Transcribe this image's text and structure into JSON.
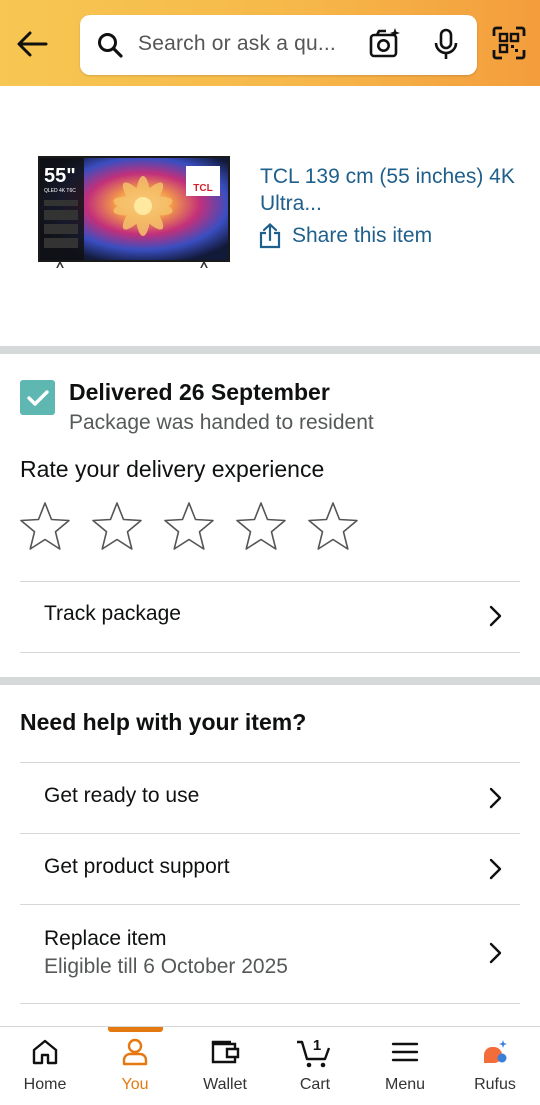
{
  "header": {
    "search_placeholder": "Search or ask a qu...",
    "back_icon": "arrow-left-icon",
    "search_icon": "search-icon",
    "camera_icon": "camera-sparkle-icon",
    "mic_icon": "microphone-icon",
    "scan_icon": "qr-scan-icon",
    "gradient_colors": [
      "#f7c752",
      "#f39d3c"
    ]
  },
  "product": {
    "title": "TCL 139 cm (55 inches) 4K Ultra...",
    "share_label": "Share this item",
    "image_text": {
      "size": "55\"",
      "model": "QLED 4K T6C",
      "brand": "TCL"
    }
  },
  "delivery": {
    "title": "Delivered 26 September",
    "subtitle": "Package was handed to resident",
    "rate_label": "Rate your delivery experience",
    "rating_value": 0,
    "rating_max": 5,
    "track_label": "Track package"
  },
  "help": {
    "title": "Need help with your item?",
    "items": [
      {
        "label": "Get ready to use"
      },
      {
        "label": "Get product support"
      },
      {
        "label": "Replace item",
        "sub": "Eligible till 6 October 2025"
      }
    ]
  },
  "nav": {
    "items": [
      {
        "label": "Home",
        "icon": "home-icon"
      },
      {
        "label": "You",
        "icon": "user-icon",
        "active": true
      },
      {
        "label": "Wallet",
        "icon": "wallet-icon"
      },
      {
        "label": "Cart",
        "icon": "cart-icon",
        "badge": "1"
      },
      {
        "label": "Menu",
        "icon": "menu-icon"
      },
      {
        "label": "Rufus",
        "icon": "rufus-icon"
      }
    ],
    "active_color": "#e47911"
  },
  "colors": {
    "link": "#1f5f8b",
    "check": "#5fb7b1",
    "divider": "#d5d9d9"
  }
}
